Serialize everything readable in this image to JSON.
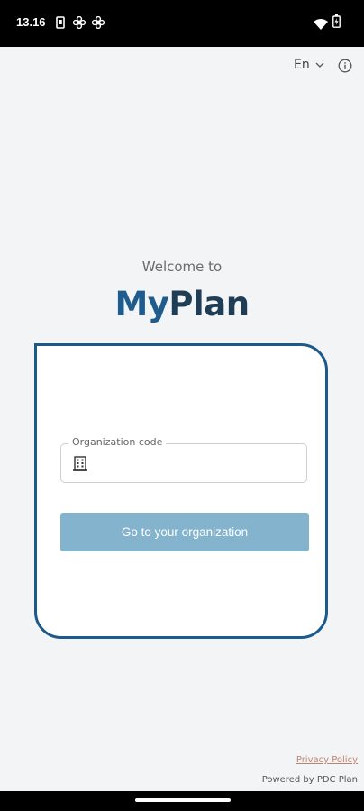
{
  "status_bar": {
    "time": "13.16",
    "icons": [
      "sim-card-icon",
      "fan-icon",
      "fan-icon",
      "wifi-icon",
      "battery-charging-icon"
    ]
  },
  "topbar": {
    "language": "En",
    "language_icon": "chevron-down-icon",
    "info_icon": "info-icon"
  },
  "welcome": {
    "greeting": "Welcome to",
    "brand_my": "My",
    "brand_plan": "Plan"
  },
  "form": {
    "org_code_label": "Organization code",
    "org_code_value": "",
    "org_code_icon": "building-icon",
    "submit_label": "Go to your organization"
  },
  "footer": {
    "privacy_label": "Privacy Policy",
    "powered_by": "Powered by PDC Plan"
  },
  "colors": {
    "brand_blue": "#1e5b8e",
    "brand_dark": "#1f3d54",
    "button_fill": "#84b3ce",
    "link": "#c0826c",
    "background": "#f3f4f5"
  }
}
